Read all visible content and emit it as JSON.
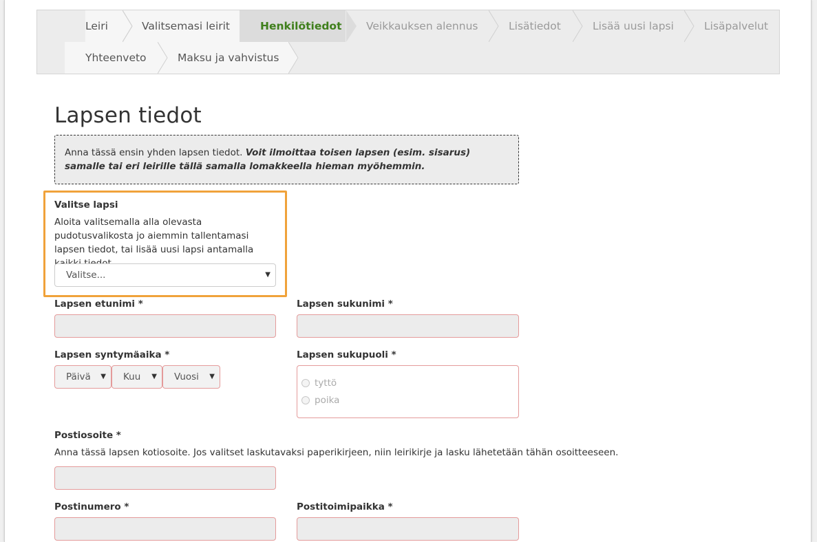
{
  "wizard": {
    "steps": [
      {
        "label": "Leiri",
        "state": "done"
      },
      {
        "label": "Valitsemasi leirit",
        "state": "done"
      },
      {
        "label": "Henkilötiedot",
        "state": "active"
      },
      {
        "label": "Veikkauksen alennus",
        "state": "todo"
      },
      {
        "label": "Lisätiedot",
        "state": "todo"
      },
      {
        "label": "Lisää uusi lapsi",
        "state": "todo"
      },
      {
        "label": "Lisäpalvelut",
        "state": "todo"
      },
      {
        "label": "Yhteenveto",
        "state": "done"
      },
      {
        "label": "Maksu ja vahvistus",
        "state": "todo"
      }
    ]
  },
  "form": {
    "title": "Lapsen tiedot",
    "notice_plain": "Anna tässä ensin yhden lapsen tiedot.",
    "notice_emphasis": "Voit ilmoittaa toisen lapsen (esim. sisarus) samalle tai eri leirille tällä samalla lomakkeella hieman myöhemmin.",
    "select_child": {
      "label": "Valitse lapsi",
      "help": "Aloita valitsemalla alla olevasta pudotusvalikosta jo aiemmin tallentamasi lapsen tiedot, tai lisää uusi lapsi antamalla kaikki tiedot.",
      "value": "Valitse..."
    },
    "first_name": {
      "label": "Lapsen etunimi *",
      "value": ""
    },
    "last_name": {
      "label": "Lapsen sukunimi *",
      "value": ""
    },
    "birthdate": {
      "label": "Lapsen syntymäaika *",
      "day": "Päivä",
      "month": "Kuu",
      "year": "Vuosi"
    },
    "gender": {
      "label": "Lapsen sukupuoli *",
      "options": [
        "tyttö",
        "poika"
      ]
    },
    "address": {
      "label": "Postiosoite *",
      "help": "Anna tässä lapsen kotiosoite. Jos valitset laskutavaksi paperikirjeen, niin leirikirje ja lasku lähetetään tähän osoitteeseen.",
      "value": ""
    },
    "postal_code": {
      "label": "Postinumero *",
      "value": ""
    },
    "city": {
      "label": "Postitoimipaikka *",
      "value": ""
    }
  },
  "colors": {
    "active_step": "#3f7f1c",
    "highlight": "#f0a23a",
    "error_border": "#e49a9a"
  }
}
